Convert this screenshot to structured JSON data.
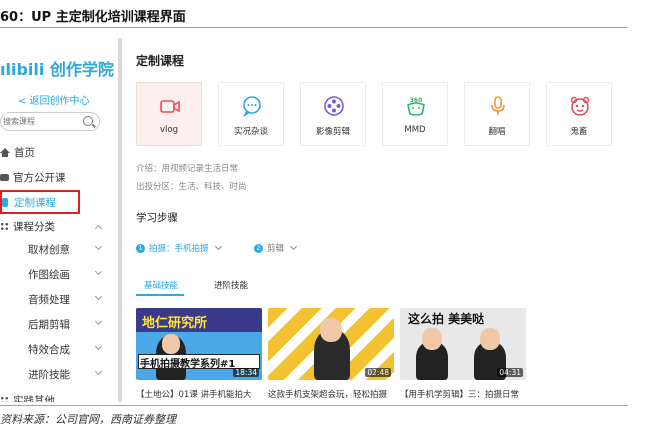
{
  "figure": {
    "title": "60：UP 主定制化培训课程界面",
    "source": "资料来源：公司官网，西南证券整理"
  },
  "sidebar": {
    "logo": "ılibili 创作学院",
    "back_link": "< 返回创作中心",
    "search_placeholder": "搜索课程",
    "nav": {
      "home": "首页",
      "public_courses": "官方公开课",
      "custom_courses": "定制课程",
      "categories": "课程分类"
    },
    "sub_items": [
      "取材创意",
      "作图绘画",
      "音频处理",
      "后期剪辑",
      "特效合成",
      "进阶技能"
    ],
    "partial_item": "实践其他"
  },
  "main": {
    "title": "定制课程",
    "tiles": [
      {
        "label": "vlog",
        "icon": "video-camera-icon",
        "color": "#e6505e"
      },
      {
        "label": "实况杂谈",
        "icon": "chat-bubble-icon",
        "color": "#2ba8e0"
      },
      {
        "label": "影像剪辑",
        "icon": "film-reel-icon",
        "color": "#7b5bd6"
      },
      {
        "label": "MMD",
        "icon": "mmd-360-icon",
        "color": "#2bb673"
      },
      {
        "label": "翻唱",
        "icon": "microphone-icon",
        "color": "#f0973a"
      },
      {
        "label": "鬼畜",
        "icon": "mascot-face-icon",
        "color": "#e6505e"
      }
    ],
    "intro": "介绍：用视频记录生活日常",
    "zones": "出投分区：生活、科技、时尚",
    "steps_title": "学习步骤",
    "steps": [
      {
        "num": "1",
        "label": "拍摄：手机拍摄"
      },
      {
        "num": "2",
        "label": "剪辑"
      }
    ],
    "tabs": [
      "基础技能",
      "进阶技能"
    ],
    "videos": [
      {
        "overlay_top": "地仁研究所",
        "overlay_caption": "手机拍摄教学系列#1",
        "duration": "18:34",
        "title": "【土地公】01课 讲手机能拍大"
      },
      {
        "duration": "02:48",
        "title": "这款手机支架超会玩，轻松拍摄"
      },
      {
        "overlay_top": "这么拍 美美哒",
        "duration": "04:31",
        "title": "【用手机学剪辑】三：拍摄日常"
      }
    ]
  },
  "colors": {
    "accent": "#2ba8e0",
    "highlight_box": "#e02020",
    "rule": "#c8a064"
  }
}
